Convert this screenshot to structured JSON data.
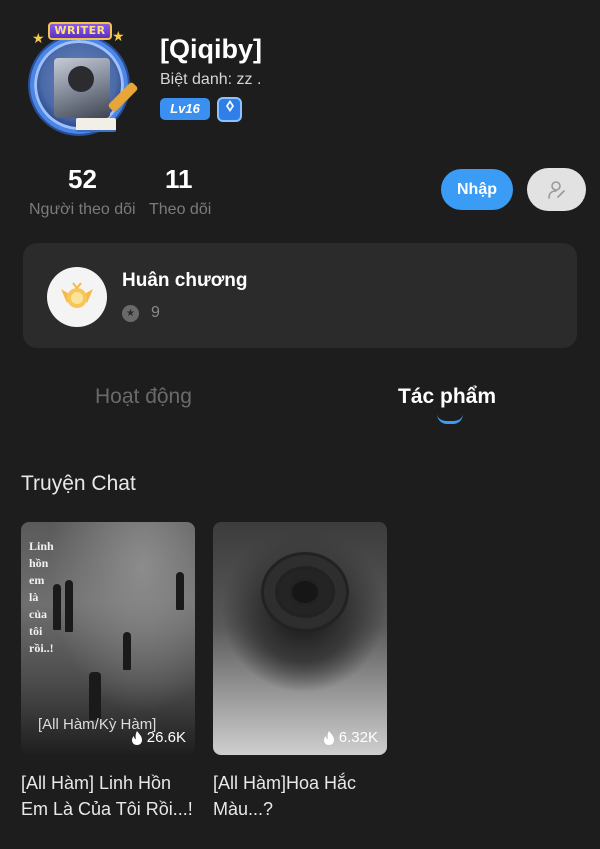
{
  "profile": {
    "username": "[Qiqiby]",
    "nickname": "Biệt danh: zz .",
    "level": "Lv16",
    "avatar_banner": "WRITER"
  },
  "stats": {
    "followers_count": "52",
    "followers_label": "Người theo dõi",
    "following_count": "11",
    "following_label": "Theo dõi"
  },
  "actions": {
    "import_label": "Nhập",
    "user_icon": "person-edit-icon"
  },
  "medal": {
    "title": "Huân chương",
    "count": "9",
    "icon": "medal-wing-icon"
  },
  "tabs": [
    {
      "label": "Hoạt động",
      "active": false
    },
    {
      "label": "Tác phẩm",
      "active": true
    }
  ],
  "section": {
    "title": "Truyện Chat"
  },
  "stories": [
    {
      "cover_text": "Linh hồn em là của tôi rồi..!",
      "tag": "[All Hàm/Kỳ Hàm]",
      "views": "26.6K",
      "title": "[All Hàm] Linh Hồn Em Là Của Tôi Rồi...!"
    },
    {
      "cover_text": "",
      "tag": "",
      "views": "6.32K",
      "title": "[All Hàm]Hoa Hắc Màu...?"
    }
  ],
  "colors": {
    "background": "#1d1d1d",
    "accent": "#3b9cf5",
    "card": "#2b2b2b"
  }
}
